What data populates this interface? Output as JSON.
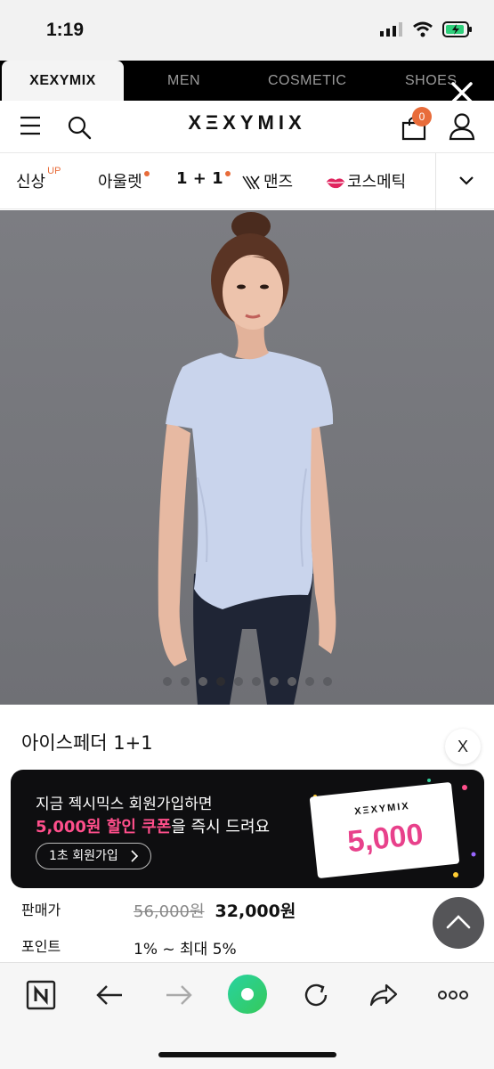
{
  "status_bar": {
    "time": "1:19"
  },
  "brand_tabs": [
    "XEXYMIX",
    "MEN",
    "COSMETIC",
    "SHOES"
  ],
  "header": {
    "logo": "XΞXYMIX",
    "cart_count": "0"
  },
  "category_nav": {
    "items": [
      {
        "label": "신상",
        "sup": "UP"
      },
      {
        "label": "아울렛"
      },
      {
        "label": "1 + 1"
      },
      {
        "label": "맨즈"
      },
      {
        "label": "코스메틱"
      }
    ]
  },
  "carousel": {
    "total": 10,
    "active_index": 3
  },
  "product": {
    "name": "아이스페더 1+1",
    "price_label": "판매가",
    "original_price": "56,000원",
    "sale_price": "32,000원",
    "point_label": "포인트",
    "point_value": "1% ~ 최대 5%"
  },
  "banner": {
    "close_label": "X",
    "line1": "지금 젝시믹스 회원가입하면",
    "line2_amount": "5,000원 할인 쿠폰",
    "line2_rest": "을 즉시 드려요",
    "join_button": "1초 회원가입",
    "coupon_logo": "XΞXYMIX",
    "coupon_amount": "5,000"
  },
  "colors": {
    "accent": "#e86c3a",
    "pink": "#ff4f8b",
    "coupon_pink": "#e8418b",
    "green": "#2ecf7b"
  }
}
